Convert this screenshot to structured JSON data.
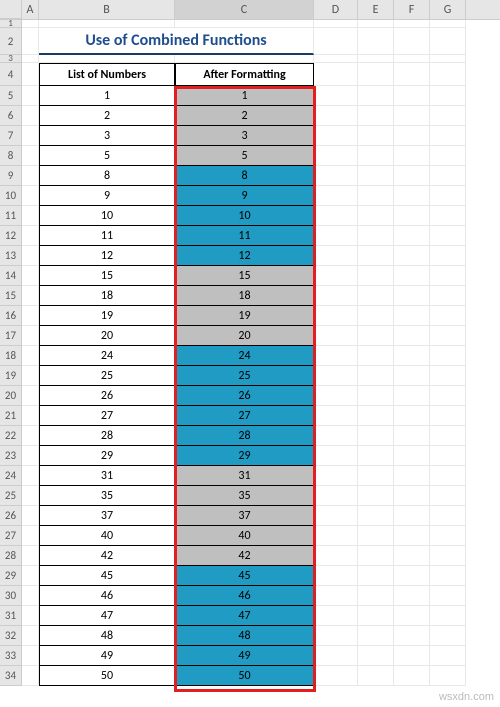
{
  "columns": [
    "A",
    "B",
    "C",
    "D",
    "E",
    "F",
    "G"
  ],
  "title": "Use of Combined Functions",
  "headers": {
    "col_b": "List of Numbers",
    "col_c": "After Formatting"
  },
  "selected_column": "C",
  "chart_data": {
    "type": "table",
    "columns": [
      "row",
      "number",
      "formatted",
      "group_color"
    ],
    "rows": [
      [
        5,
        1,
        1,
        "grey"
      ],
      [
        6,
        2,
        2,
        "grey"
      ],
      [
        7,
        3,
        3,
        "grey"
      ],
      [
        8,
        5,
        5,
        "grey"
      ],
      [
        9,
        8,
        8,
        "blue"
      ],
      [
        10,
        9,
        9,
        "blue"
      ],
      [
        11,
        10,
        10,
        "blue"
      ],
      [
        12,
        11,
        11,
        "blue"
      ],
      [
        13,
        12,
        12,
        "blue"
      ],
      [
        14,
        15,
        15,
        "grey"
      ],
      [
        15,
        18,
        18,
        "grey"
      ],
      [
        16,
        19,
        19,
        "grey"
      ],
      [
        17,
        20,
        20,
        "grey"
      ],
      [
        18,
        24,
        24,
        "blue"
      ],
      [
        19,
        25,
        25,
        "blue"
      ],
      [
        20,
        26,
        26,
        "blue"
      ],
      [
        21,
        27,
        27,
        "blue"
      ],
      [
        22,
        28,
        28,
        "blue"
      ],
      [
        23,
        29,
        29,
        "blue"
      ],
      [
        24,
        31,
        31,
        "grey"
      ],
      [
        25,
        35,
        35,
        "grey"
      ],
      [
        26,
        37,
        37,
        "grey"
      ],
      [
        27,
        40,
        40,
        "grey"
      ],
      [
        28,
        42,
        42,
        "grey"
      ],
      [
        29,
        45,
        45,
        "blue"
      ],
      [
        30,
        46,
        46,
        "blue"
      ],
      [
        31,
        47,
        47,
        "blue"
      ],
      [
        32,
        48,
        48,
        "blue"
      ],
      [
        33,
        49,
        49,
        "blue"
      ],
      [
        34,
        50,
        50,
        "blue"
      ]
    ]
  },
  "row_labels_pre": [
    "1",
    "2",
    "3",
    "4"
  ],
  "watermark": "wsxdn.com"
}
